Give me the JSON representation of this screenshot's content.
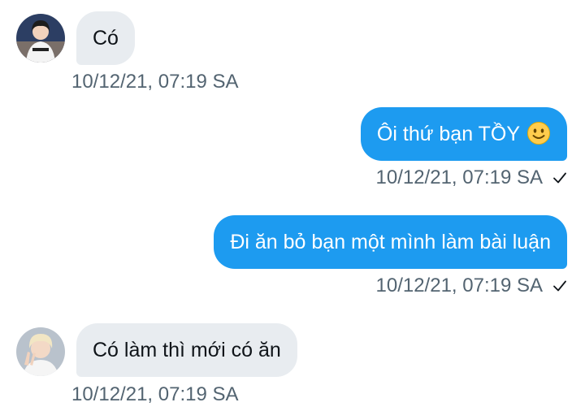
{
  "messages": [
    {
      "direction": "incoming",
      "text": "Có",
      "timestamp": "10/12/21, 07:19 SA",
      "avatar": "user-avatar-1"
    },
    {
      "direction": "outgoing",
      "text": "Ôi thứ bạn TỒY",
      "emoji": "slightly-smiling-face",
      "timestamp": "10/12/21, 07:19 SA",
      "status_icon": "checkmark-icon"
    },
    {
      "direction": "outgoing",
      "text": "Đi ăn bỏ bạn một mình làm bài luận",
      "timestamp": "10/12/21, 07:19 SA",
      "status_icon": "checkmark-icon"
    },
    {
      "direction": "incoming",
      "text": "Có làm thì mới có ăn",
      "timestamp": "10/12/21, 07:19 SA",
      "avatar": "user-avatar-2"
    }
  ],
  "colors": {
    "outgoing_bubble": "#1d9bf0",
    "incoming_bubble": "#e8ecf0",
    "timestamp": "#536471"
  }
}
